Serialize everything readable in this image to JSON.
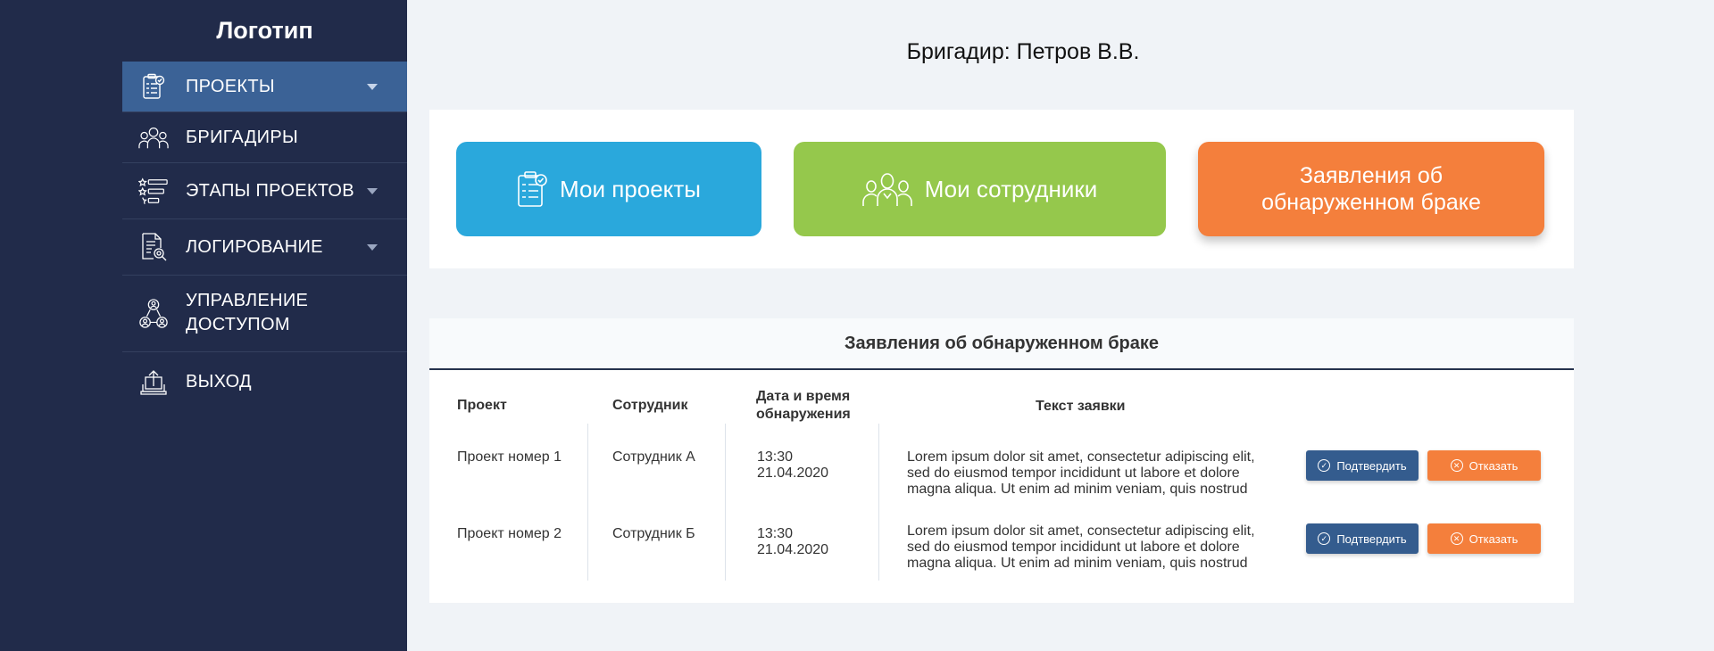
{
  "sidebar": {
    "logo": "Логотип",
    "items": [
      {
        "label": "ПРОЕКТЫ",
        "icon": "clipboard-check-icon",
        "active": true,
        "has_submenu": true
      },
      {
        "label": "БРИГАДИРЫ",
        "icon": "people-group-icon",
        "active": false,
        "has_submenu": false
      },
      {
        "label": "ЭТАПЫ ПРОЕКТОВ",
        "icon": "star-list-icon",
        "active": false,
        "has_submenu": true
      },
      {
        "label": "ЛОГИРОВАНИЕ",
        "icon": "document-search-icon",
        "active": false,
        "has_submenu": true
      },
      {
        "label_lines": [
          "УПРАВЛЕНИЕ",
          "ДОСТУПОМ"
        ],
        "icon": "access-users-icon",
        "active": false,
        "has_submenu": false
      },
      {
        "label": "ВЫХОД",
        "icon": "logout-upload-icon",
        "active": false,
        "has_submenu": false
      }
    ]
  },
  "header": {
    "title": "Бригадир: Петров В.В."
  },
  "tiles": {
    "projects": "Мои проекты",
    "staff": "Мои сотрудники",
    "defects_lines": [
      "Заявления об",
      "обнаруженном браке"
    ]
  },
  "defects_table": {
    "title": "Заявления об обнаруженном браке",
    "columns": {
      "project": "Проект",
      "employee": "Сотрудник",
      "datetime_lines": [
        "Дата и время",
        "обнаружения"
      ],
      "text": "Текст заявки"
    },
    "rows": [
      {
        "project": "Проект номер 1",
        "employee": "Сотрудник А",
        "time": "13:30",
        "date": "21.04.2020",
        "text_lines": [
          "Lorem ipsum dolor sit amet, consectetur adipiscing elit,",
          "sed do eiusmod tempor incididunt ut labore et dolore",
          "magna aliqua. Ut enim ad minim veniam, quis nostrud"
        ],
        "confirm_label": "Подтвердить",
        "reject_label": "Отказать"
      },
      {
        "project": "Проект номер 2",
        "employee": "Сотрудник Б",
        "time": "13:30",
        "date": "21.04.2020",
        "text_lines": [
          "Lorem ipsum dolor sit amet, consectetur adipiscing elit,",
          "sed do eiusmod tempor incididunt ut labore et dolore",
          "magna aliqua. Ut enim ad minim veniam, quis nostrud"
        ],
        "confirm_label": "Подтвердить",
        "reject_label": "Отказать"
      }
    ]
  },
  "colors": {
    "sidebar_bg": "#212b4a",
    "active_item": "#3b6296",
    "tile_blue": "#2aa8dc",
    "tile_green": "#95c84c",
    "tile_orange": "#f47f3c",
    "confirm": "#345c8e"
  }
}
